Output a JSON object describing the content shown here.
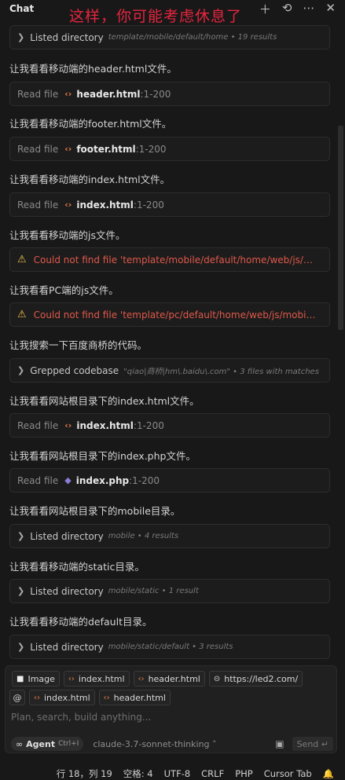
{
  "header": {
    "title": "Chat",
    "overlay_text": "这样，你可能考虑休息了",
    "icons": [
      "plus-icon",
      "history-icon",
      "more-icon",
      "close-icon"
    ]
  },
  "cards": [
    {
      "kind": "dir",
      "label": "Listed directory",
      "sub": "template/mobile/default/home • 19 results"
    },
    {
      "kind": "file",
      "verb": "Read file",
      "name": "header.html",
      "lines": ":1-200",
      "icon": "code"
    },
    {
      "kind": "file",
      "verb": "Read file",
      "name": "footer.html",
      "lines": ":1-200",
      "icon": "code"
    },
    {
      "kind": "file",
      "verb": "Read file",
      "name": "index.html",
      "lines": ":1-200",
      "icon": "code"
    },
    {
      "kind": "error",
      "text": "Could not find file 'template/mobile/default/home/web/js/mobile-..."
    },
    {
      "kind": "error",
      "text": "Could not find file 'template/pc/default/home/web/js/mobile-nav.j..."
    },
    {
      "kind": "dir",
      "label": "Grepped codebase",
      "sub": "\"qiao|商桥|hm\\.baidu\\.com\" • 3 files with matches"
    },
    {
      "kind": "file",
      "verb": "Read file",
      "name": "index.html",
      "lines": ":1-200",
      "icon": "code"
    },
    {
      "kind": "file",
      "verb": "Read file",
      "name": "index.php",
      "lines": ":1-200",
      "icon": "php"
    },
    {
      "kind": "dir",
      "label": "Listed directory",
      "sub": "mobile • 4 results"
    },
    {
      "kind": "dir",
      "label": "Listed directory",
      "sub": "mobile/static • 1 result"
    },
    {
      "kind": "dir",
      "label": "Listed directory",
      "sub": "mobile/static/default • 3 results"
    }
  ],
  "messages": [
    "让我看看移动端的header.html文件。",
    "让我看看移动端的footer.html文件。",
    "让我看看移动端的index.html文件。",
    "让我看看移动端的js文件。",
    "让我看看PC端的js文件。",
    "让我搜索一下百度商桥的代码。",
    "让我看看网站根目录下的index.html文件。",
    "让我看看网站根目录下的index.php文件。",
    "让我看看网站根目录下的mobile目录。",
    "让我看看移动端的static目录。",
    "让我看看移动端的default目录。"
  ],
  "composer": {
    "context_chips": [
      {
        "label": "Image",
        "icon": "image-icon"
      },
      {
        "label": "index.html",
        "icon": "code-icon"
      },
      {
        "label": "header.html",
        "icon": "code-icon"
      },
      {
        "label": "https://led2.com/",
        "icon": "link-icon"
      }
    ],
    "at_label": "@",
    "file_chips": [
      "index.html",
      "header.html"
    ],
    "placeholder": "Plan, search, build anything...",
    "agent_label": "Agent",
    "agent_shortcut": "Ctrl+I",
    "model_label": "claude-3.7-sonnet-thinking",
    "send_label": "Send"
  },
  "status": {
    "position": "行 18，列 19",
    "spaces": "空格: 4",
    "encoding": "UTF-8",
    "eol": "CRLF",
    "language": "PHP",
    "mode": "Cursor Tab"
  }
}
